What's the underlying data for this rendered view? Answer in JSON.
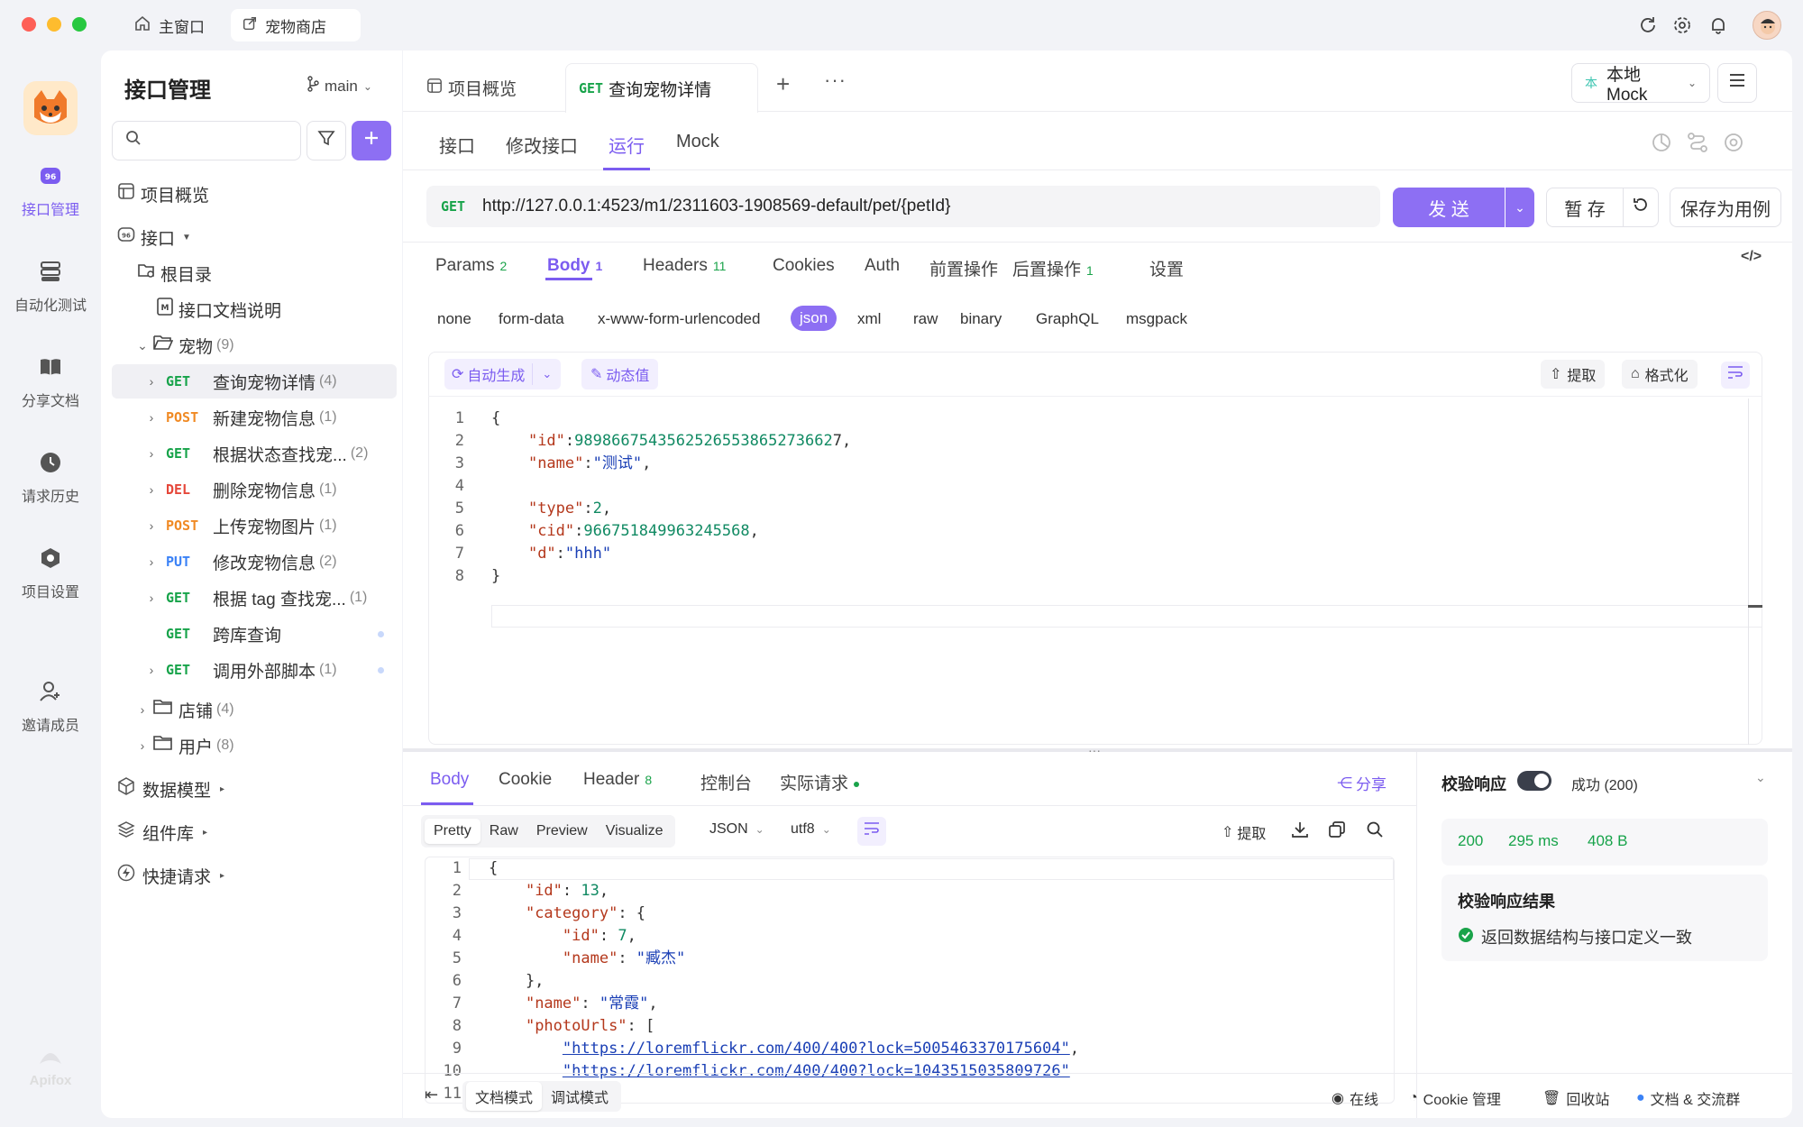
{
  "window": {
    "tabs": [
      {
        "label": "主窗口"
      },
      {
        "label": "宠物商店"
      }
    ]
  },
  "rail": {
    "app_name": "Apifox",
    "items": [
      {
        "label": "接口管理"
      },
      {
        "label": "自动化测试"
      },
      {
        "label": "分享文档"
      },
      {
        "label": "请求历史"
      },
      {
        "label": "项目设置"
      },
      {
        "label": "邀请成员"
      }
    ]
  },
  "sidebar": {
    "title": "接口管理",
    "branch": "main",
    "search_placeholder": "",
    "overview": "项目概览",
    "api_root": "接口",
    "root_dir": "根目录",
    "doc": "接口文档说明",
    "pet_folder": {
      "label": "宠物",
      "count": "(9)"
    },
    "endpoints": [
      {
        "method": "GET",
        "label": "查询宠物详情",
        "count": "(4)"
      },
      {
        "method": "POST",
        "label": "新建宠物信息",
        "count": "(1)"
      },
      {
        "method": "GET",
        "label": "根据状态查找宠...",
        "count": "(2)"
      },
      {
        "method": "DEL",
        "label": "删除宠物信息",
        "count": "(1)"
      },
      {
        "method": "POST",
        "label": "上传宠物图片",
        "count": "(1)"
      },
      {
        "method": "PUT",
        "label": "修改宠物信息",
        "count": "(2)"
      },
      {
        "method": "GET",
        "label": "根据 tag 查找宠...",
        "count": "(1)"
      },
      {
        "method": "GET",
        "label": "跨库查询",
        "count": ""
      },
      {
        "method": "GET",
        "label": "调用外部脚本",
        "count": "(1)"
      }
    ],
    "folders": [
      {
        "label": "店铺",
        "count": "(4)"
      },
      {
        "label": "用户",
        "count": "(8)"
      }
    ],
    "bottom": [
      {
        "label": "数据模型"
      },
      {
        "label": "组件库"
      },
      {
        "label": "快捷请求"
      }
    ]
  },
  "topbar": {
    "tabs": [
      {
        "label": "项目概览"
      },
      {
        "method": "GET",
        "label": "查询宠物详情"
      }
    ],
    "env": "本地 Mock",
    "env_badge": "本"
  },
  "subtabs": [
    "接口",
    "修改接口",
    "运行",
    "Mock"
  ],
  "request": {
    "method": "GET",
    "url": "http://127.0.0.1:4523/m1/2311603-1908569-default/pet/{petId}",
    "send": "发 送",
    "save": "暂 存",
    "save_case": "保存为用例"
  },
  "req_tabs": [
    {
      "label": "Params",
      "badge": "2"
    },
    {
      "label": "Body",
      "badge": "1"
    },
    {
      "label": "Headers",
      "badge": "11"
    },
    {
      "label": "Cookies",
      "badge": ""
    },
    {
      "label": "Auth",
      "badge": ""
    },
    {
      "label": "前置操作",
      "badge": ""
    },
    {
      "label": "后置操作",
      "badge": "1"
    },
    {
      "label": "设置",
      "badge": ""
    }
  ],
  "body_types": [
    "none",
    "form-data",
    "x-www-form-urlencoded",
    "json",
    "xml",
    "raw",
    "binary",
    "GraphQL",
    "msgpack"
  ],
  "editor": {
    "auto_gen": "自动生成",
    "dynamic": "动态值",
    "extract": "提取",
    "format": "格式化",
    "lines": [
      {
        "n": "1",
        "code": "{"
      },
      {
        "n": "2",
        "code": "    \"id\":9898667543562526553865273662​7,"
      },
      {
        "n": "3",
        "code": "    \"name\":\"测试\","
      },
      {
        "n": "4",
        "code": ""
      },
      {
        "n": "5",
        "code": "    \"type\":2,"
      },
      {
        "n": "6",
        "code": "    \"cid\":966751849963245568,"
      },
      {
        "n": "7",
        "code": "    \"d\":\"hhh\""
      },
      {
        "n": "8",
        "code": "}"
      }
    ]
  },
  "response": {
    "tabs": [
      {
        "label": "Body",
        "badge": ""
      },
      {
        "label": "Cookie",
        "badge": ""
      },
      {
        "label": "Header",
        "badge": "8"
      },
      {
        "label": "控制台",
        "badge": ""
      },
      {
        "label": "实际请求",
        "badge": ""
      }
    ],
    "share": "分享",
    "views": [
      "Pretty",
      "Raw",
      "Preview",
      "Visualize"
    ],
    "format": "JSON",
    "encoding": "utf8",
    "extract": "提取",
    "lines": [
      {
        "n": "1",
        "code": "{"
      },
      {
        "n": "2",
        "code": "    \"id\": 13,"
      },
      {
        "n": "3",
        "code": "    \"category\": {"
      },
      {
        "n": "4",
        "code": "        \"id\": 7,"
      },
      {
        "n": "5",
        "code": "        \"name\": \"臧杰\""
      },
      {
        "n": "6",
        "code": "    },"
      },
      {
        "n": "7",
        "code": "    \"name\": \"常霞\","
      },
      {
        "n": "8",
        "code": "    \"photoUrls\": ["
      },
      {
        "n": "9",
        "code": "        \"https://loremflickr.com/400/400?lock=5005463370175604\","
      },
      {
        "n": "10",
        "code": "        \"https://loremflickr.com/400/400?lock=1043515035809726\""
      },
      {
        "n": "11",
        "code": "    ],"
      }
    ]
  },
  "validate": {
    "label": "校验响应",
    "status": "成功 (200)",
    "code": "200",
    "time": "295 ms",
    "size": "408 B",
    "result_title": "校验响应结果",
    "result": "返回数据结构与接口定义一致"
  },
  "statusbar": {
    "doc_mode": "文档模式",
    "debug_mode": "调试模式",
    "online": "在线",
    "cookie": "Cookie 管理",
    "trash": "回收站",
    "community": "文档 & 交流群"
  }
}
